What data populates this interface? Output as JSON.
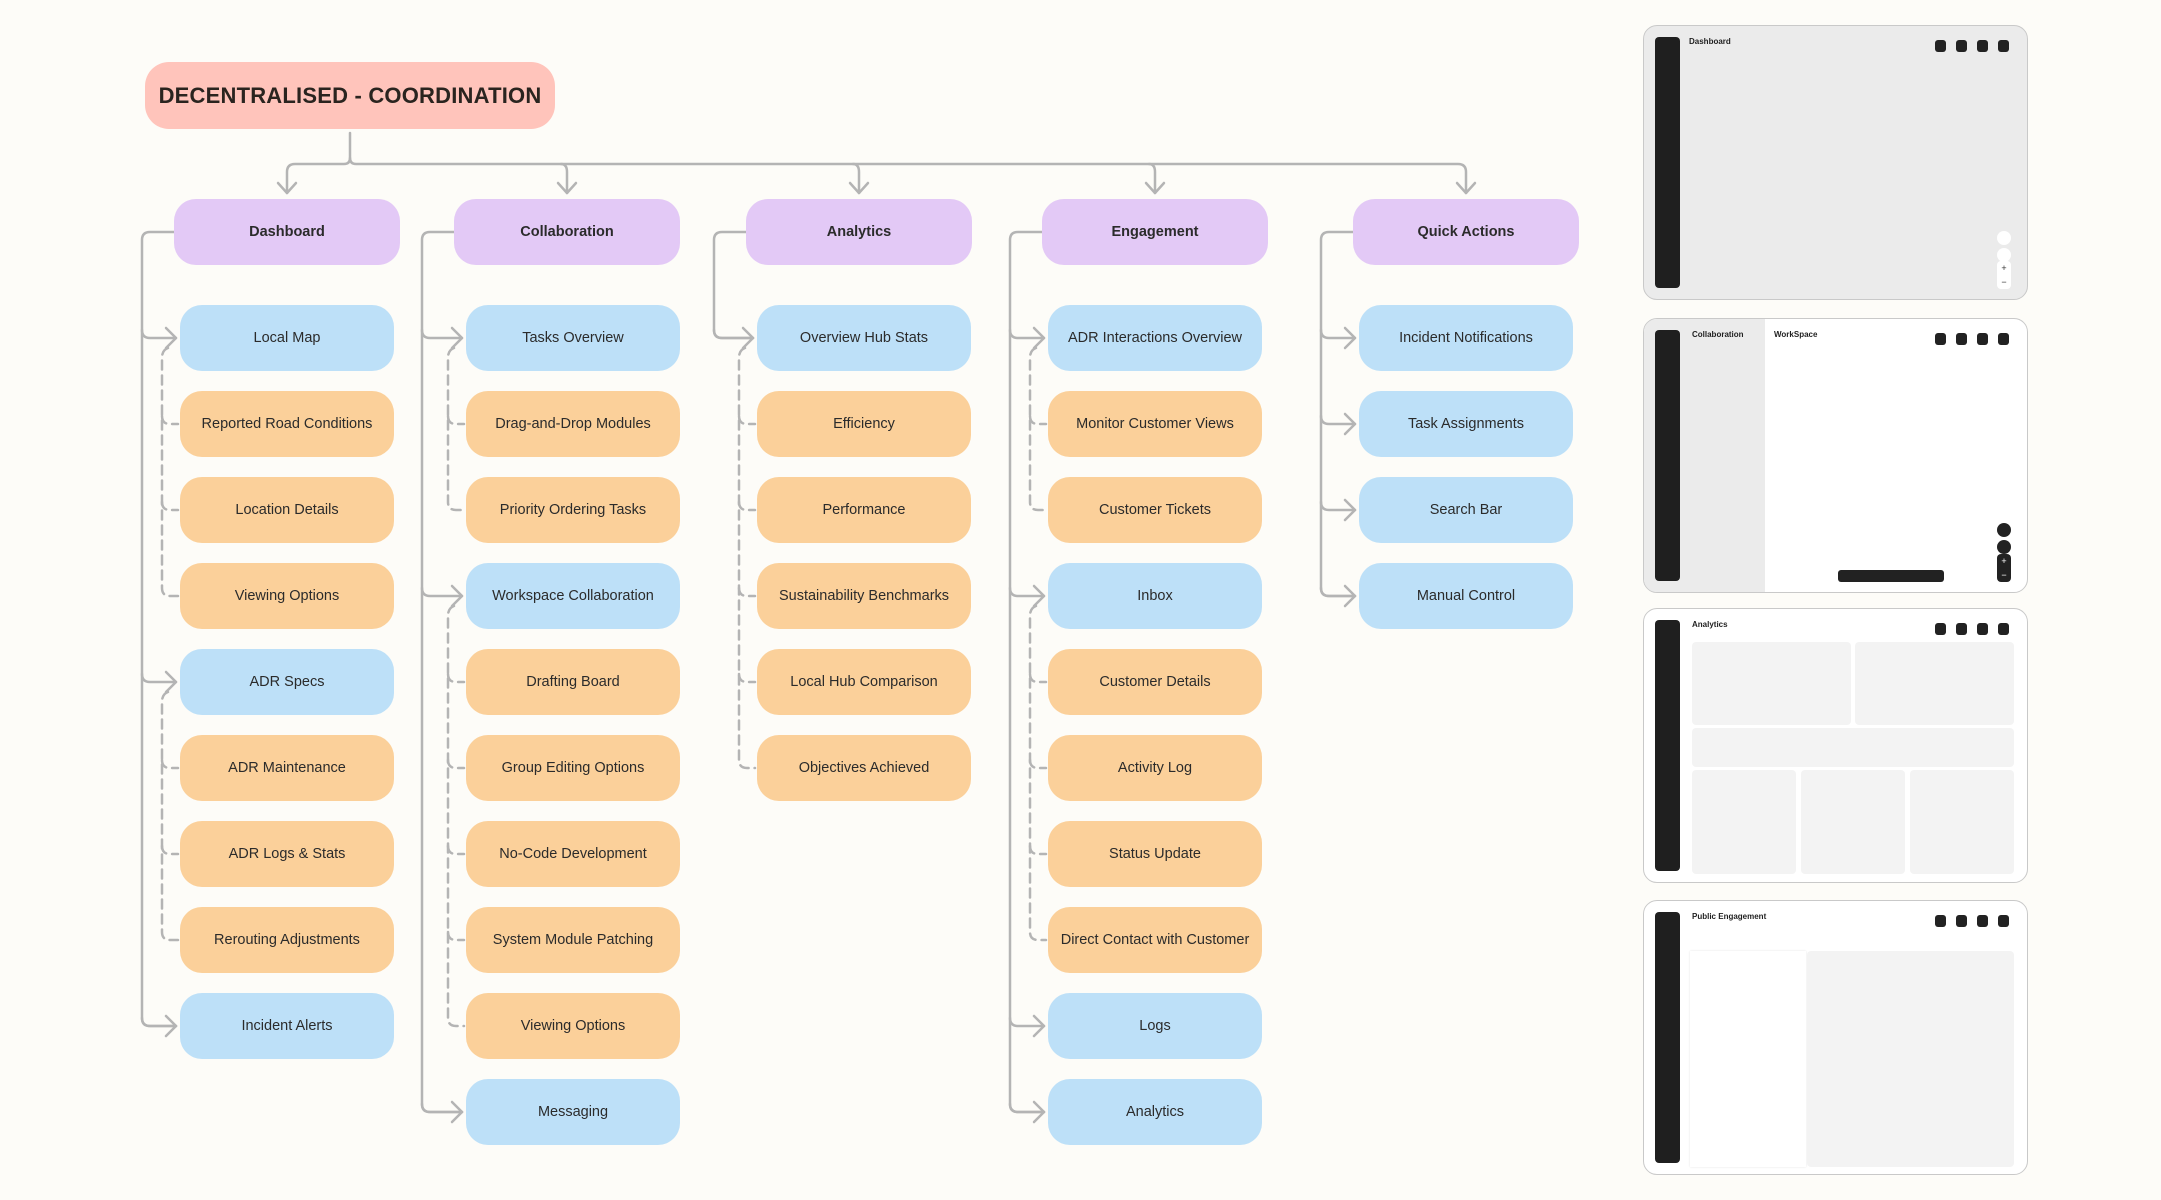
{
  "root": {
    "label": "DECENTRALISED - COORDINATION"
  },
  "colors": {
    "background": "#fdfcf8",
    "root": "#ffc4bb",
    "section": "#e3c9f6",
    "primary": "#bde0f8",
    "secondary": "#fbd09a",
    "connector": "#b4b4b4",
    "dark": "#1f1f1f"
  },
  "columns": [
    {
      "label": "Dashboard",
      "items": [
        {
          "label": "Local Map",
          "type": "primary"
        },
        {
          "label": "Reported Road Conditions",
          "type": "secondary"
        },
        {
          "label": "Location Details",
          "type": "secondary"
        },
        {
          "label": "Viewing Options",
          "type": "secondary"
        },
        {
          "label": "ADR Specs",
          "type": "primary"
        },
        {
          "label": "ADR Maintenance",
          "type": "secondary"
        },
        {
          "label": "ADR Logs & Stats",
          "type": "secondary"
        },
        {
          "label": "Rerouting Adjustments",
          "type": "secondary"
        },
        {
          "label": "Incident Alerts",
          "type": "primary"
        }
      ]
    },
    {
      "label": "Collaboration",
      "items": [
        {
          "label": "Tasks Overview",
          "type": "primary"
        },
        {
          "label": "Drag-and-Drop Modules",
          "type": "secondary"
        },
        {
          "label": "Priority Ordering Tasks",
          "type": "secondary"
        },
        {
          "label": "Workspace Collaboration",
          "type": "primary"
        },
        {
          "label": "Drafting Board",
          "type": "secondary"
        },
        {
          "label": "Group Editing Options",
          "type": "secondary"
        },
        {
          "label": "No-Code Development",
          "type": "secondary"
        },
        {
          "label": "System Module Patching",
          "type": "secondary"
        },
        {
          "label": "Viewing Options",
          "type": "secondary"
        },
        {
          "label": "Messaging",
          "type": "primary"
        }
      ]
    },
    {
      "label": "Analytics",
      "items": [
        {
          "label": "Overview Hub Stats",
          "type": "primary"
        },
        {
          "label": "Efficiency",
          "type": "secondary"
        },
        {
          "label": "Performance",
          "type": "secondary"
        },
        {
          "label": "Sustainability Benchmarks",
          "type": "secondary"
        },
        {
          "label": "Local Hub Comparison",
          "type": "secondary"
        },
        {
          "label": "Objectives Achieved",
          "type": "secondary"
        }
      ]
    },
    {
      "label": "Engagement",
      "items": [
        {
          "label": "ADR Interactions Overview",
          "type": "primary"
        },
        {
          "label": "Monitor Customer Views",
          "type": "secondary"
        },
        {
          "label": "Customer Tickets",
          "type": "secondary"
        },
        {
          "label": "Inbox",
          "type": "primary"
        },
        {
          "label": "Customer Details",
          "type": "secondary"
        },
        {
          "label": "Activity Log",
          "type": "secondary"
        },
        {
          "label": "Status Update",
          "type": "secondary"
        },
        {
          "label": "Direct Contact with Customer",
          "type": "secondary"
        },
        {
          "label": "Logs",
          "type": "primary"
        },
        {
          "label": "Analytics",
          "type": "primary"
        }
      ]
    },
    {
      "label": "Quick Actions",
      "items": [
        {
          "label": "Incident Notifications",
          "type": "primary"
        },
        {
          "label": "Task Assignments",
          "type": "primary"
        },
        {
          "label": "Search Bar",
          "type": "primary"
        },
        {
          "label": "Manual Control",
          "type": "primary"
        }
      ]
    }
  ],
  "thumbnails": [
    {
      "title": "Dashboard",
      "zoom_plus": "+",
      "zoom_minus": "−"
    },
    {
      "title": "Collaboration",
      "subtitle": "WorkSpace",
      "zoom_plus": "+",
      "zoom_minus": "−"
    },
    {
      "title": "Analytics"
    },
    {
      "title": "Public Engagement"
    }
  ]
}
